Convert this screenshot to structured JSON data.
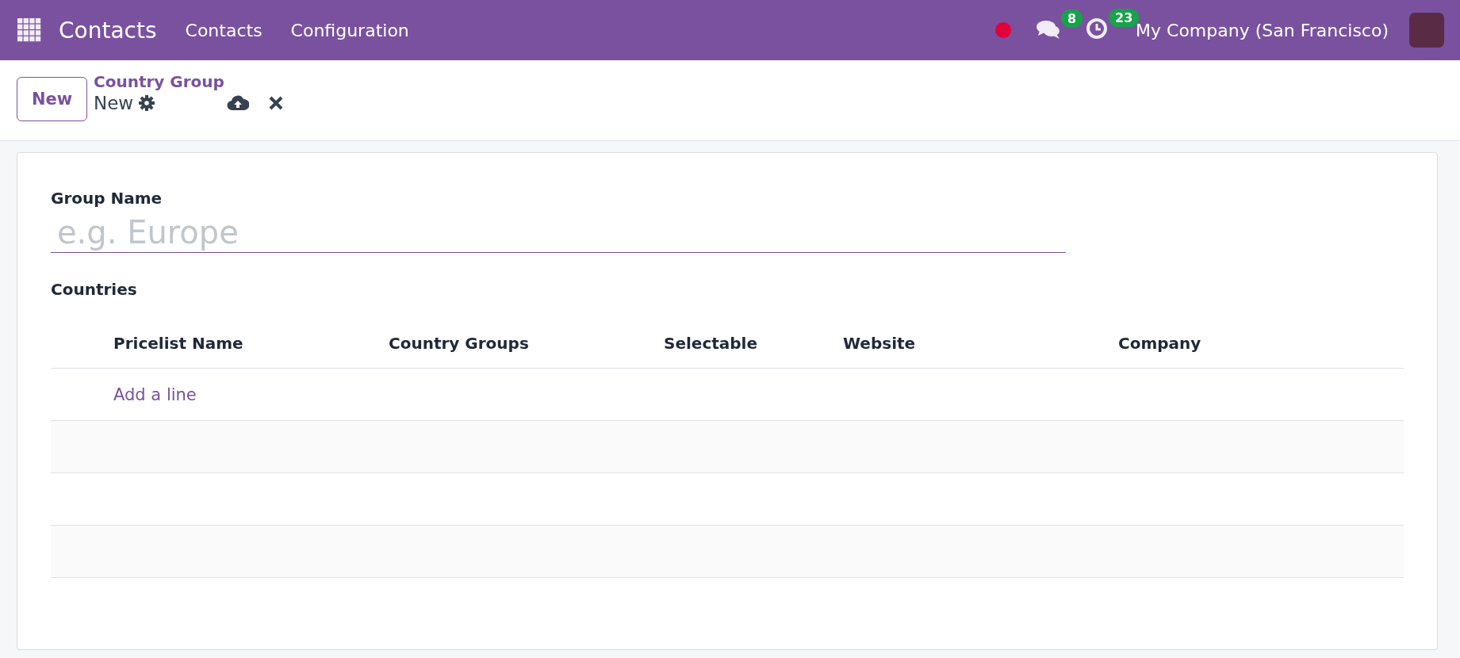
{
  "navbar": {
    "app_name": "Contacts",
    "menus": [
      "Contacts",
      "Configuration"
    ],
    "messages_badge": "8",
    "activities_badge": "23",
    "company": "My Company (San Francisco)"
  },
  "control_panel": {
    "new_button": "New",
    "breadcrumb": "Country Group",
    "record_name": "New"
  },
  "form": {
    "group_name": {
      "label": "Group Name",
      "placeholder": "e.g. Europe"
    },
    "countries": {
      "label": "Countries",
      "columns": [
        "Pricelist Name",
        "Country Groups",
        "Selectable",
        "Website",
        "Company"
      ],
      "add_line": "Add a line"
    }
  }
}
